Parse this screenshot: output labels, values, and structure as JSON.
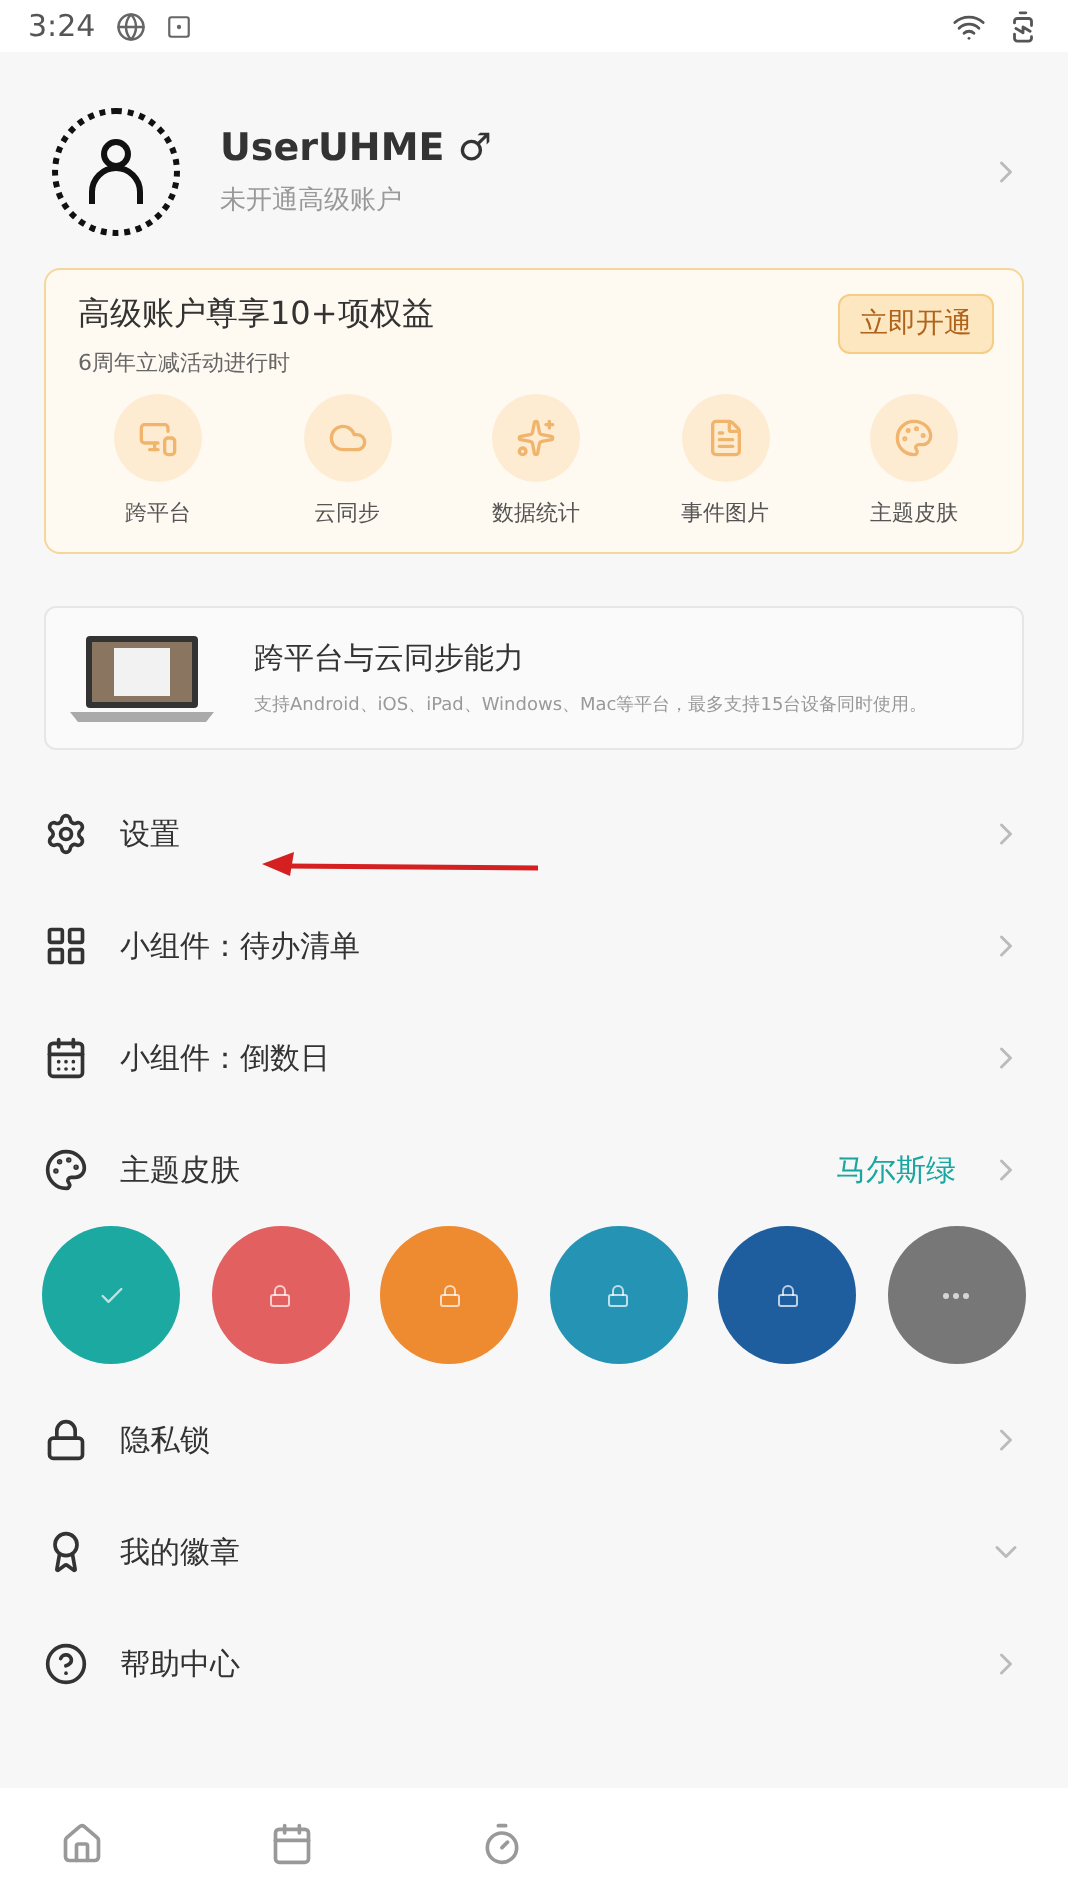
{
  "status_bar": {
    "time": "3:24"
  },
  "profile": {
    "name": "UserUHME",
    "gender": "♂",
    "subtitle": "未开通高级账户"
  },
  "premium": {
    "title": "高级账户尊享10+项权益",
    "subtitle": "6周年立减活动进行时",
    "button": "立即开通",
    "features": [
      {
        "kind": "devices",
        "label": "跨平台"
      },
      {
        "kind": "cloud",
        "label": "云同步"
      },
      {
        "kind": "stats",
        "label": "数据统计"
      },
      {
        "kind": "file",
        "label": "事件图片"
      },
      {
        "kind": "palette",
        "label": "主题皮肤"
      }
    ]
  },
  "promo": {
    "title": "跨平台与云同步能力",
    "text": "支持Android、iOS、iPad、Windows、Mac等平台，最多支持15台设备同时使用。"
  },
  "menu": [
    {
      "kind": "settings",
      "label": "设置",
      "expandable": false
    },
    {
      "kind": "widget",
      "label": "小组件：待办清单",
      "expandable": false
    },
    {
      "kind": "calendar",
      "label": "小组件：倒数日",
      "expandable": false
    },
    {
      "kind": "palette",
      "label": "主题皮肤",
      "expandable": false,
      "value": "马尔斯绿",
      "swatches": [
        {
          "color": "#1ba9a2",
          "selected": true
        },
        {
          "kind": "locked",
          "color": "#e36060",
          "selected": false
        },
        {
          "kind": "locked",
          "color": "#ee8a30",
          "selected": false
        },
        {
          "kind": "locked",
          "color": "#2594b4",
          "selected": false
        },
        {
          "kind": "locked",
          "color": "#1e5e9f",
          "selected": false
        },
        {
          "kind": "more",
          "color": "#777777",
          "selected": false
        }
      ]
    },
    {
      "kind": "lock",
      "label": "隐私锁",
      "expandable": false
    },
    {
      "kind": "badge",
      "label": "我的徽章",
      "expandable": true
    },
    {
      "kind": "help",
      "label": "帮助中心",
      "expandable": false
    }
  ],
  "bottom_nav": [
    {
      "kind": "home"
    },
    {
      "kind": "calendar"
    },
    {
      "kind": "timer"
    }
  ]
}
